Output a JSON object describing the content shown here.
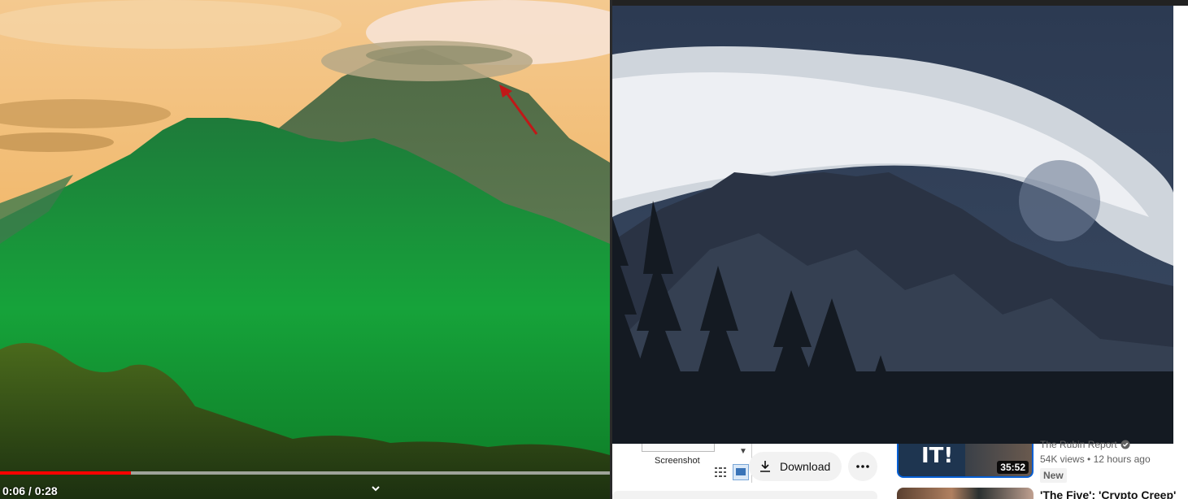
{
  "player": {
    "time_display": "0:06 / 0:28",
    "progress_fraction": 0.214
  },
  "popup": {
    "label": "Screenshot"
  },
  "actions": {
    "download_label": "Download"
  },
  "recommended": [
    {
      "thumb_text": "IT!",
      "duration": "35:52",
      "channel": "The Rubin Report",
      "views": "54K views",
      "age": "12 hours ago",
      "badge": "New"
    },
    {
      "title": "'The Five': 'Crypto Creep'"
    }
  ],
  "colors": {
    "progress": "#ff0000",
    "selected_outline": "#065fd4"
  }
}
